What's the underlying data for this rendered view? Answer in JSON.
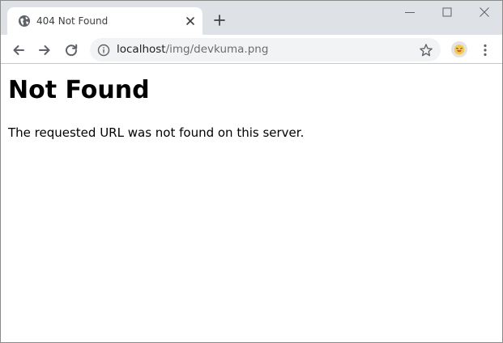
{
  "tab": {
    "title": "404 Not Found",
    "favicon_icon": "globe-icon"
  },
  "window_controls": [
    "minimize-icon",
    "maximize-icon",
    "close-icon"
  ],
  "toolbar": {
    "url_host": "localhost",
    "url_path": "/img/devkuma.png",
    "icons": [
      "back-arrow-icon",
      "forward-arrow-icon",
      "reload-icon",
      "info-icon",
      "star-icon",
      "profile-avatar-icon",
      "kebab-menu-icon"
    ]
  },
  "page": {
    "heading": "Not Found",
    "message": "The requested URL was not found on this server."
  },
  "colors": {
    "tabstrip": "#dee1e6",
    "omnibox": "#f1f3f4",
    "icon": "#5f6368"
  }
}
